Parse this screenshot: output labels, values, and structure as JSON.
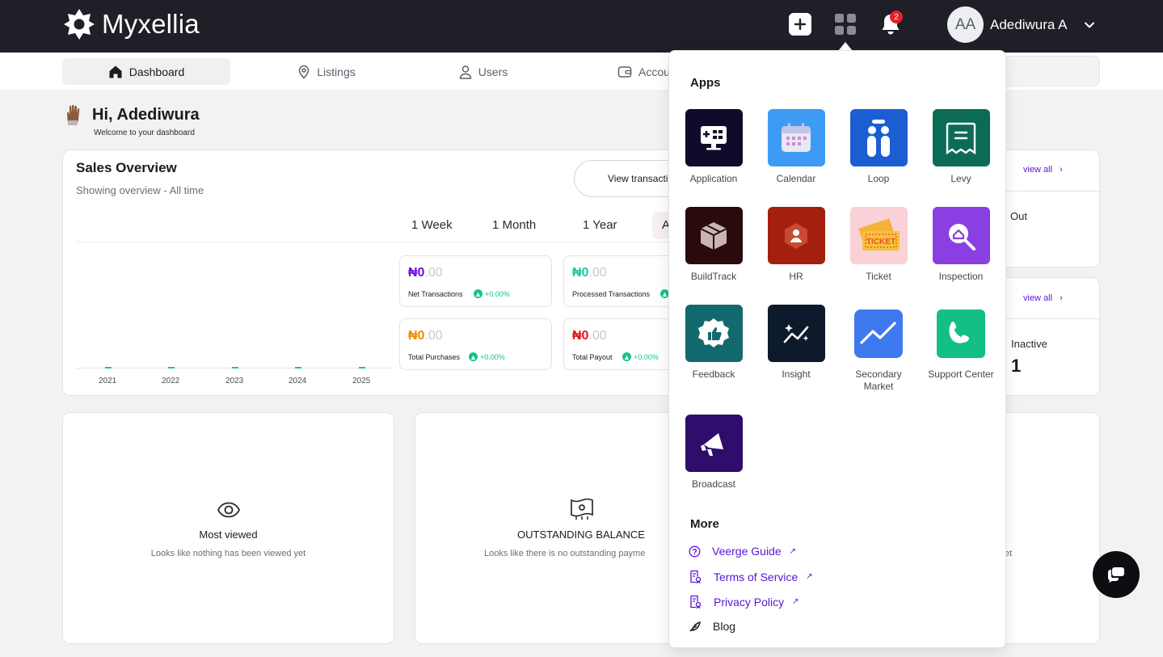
{
  "header": {
    "brand": "Myxellia",
    "notification_count": "2",
    "avatar_initials": "AA",
    "user_name": "Adediwura A"
  },
  "nav": {
    "items": [
      {
        "label": "Dashboard",
        "icon": "home-icon",
        "active": true
      },
      {
        "label": "Listings",
        "icon": "location-pin-icon"
      },
      {
        "label": "Users",
        "icon": "user-icon"
      },
      {
        "label": "Accou",
        "icon": "wallet-icon"
      }
    ]
  },
  "greeting": {
    "title": "Hi, Adediwura",
    "subtitle": "Welcome to your dashboard"
  },
  "sales_overview": {
    "title": "Sales Overview",
    "subtitle": "Showing overview - All time",
    "view_button": "View transacti",
    "periods": [
      "1 Week",
      "1 Month",
      "1 Year",
      "A"
    ],
    "years": [
      "2021",
      "2022",
      "2023",
      "2024",
      "2025"
    ],
    "stats": [
      {
        "currency": "₦0",
        "decimals": ".00",
        "label": "Net Transactions",
        "change": "+0.00%",
        "color": "#6b0fe0"
      },
      {
        "currency": "₦0",
        "decimals": ".00",
        "label": "Processed Transactions",
        "change": "",
        "color": "#1ac9a0"
      },
      {
        "currency": "₦0",
        "decimals": ".00",
        "label": "Total Purchases",
        "change": "+0.00%",
        "color": "#f08a00"
      },
      {
        "currency": "₦0",
        "decimals": ".00",
        "label": "Total Payout",
        "change": "+0.00%",
        "color": "#e0141c"
      }
    ]
  },
  "side_cards": [
    {
      "view_all": "view all",
      "text": "Out"
    },
    {
      "view_all": "view all",
      "text": "Inactive",
      "value": "1"
    }
  ],
  "empty_states": [
    {
      "title": "Most viewed",
      "subtitle": "Looks like nothing has been viewed yet",
      "icon": "eye-icon"
    },
    {
      "title": "OUTSTANDING BALANCE",
      "subtitle": "Looks like there is no outstanding payme",
      "icon": "money-icon"
    },
    {
      "subtitle": "et"
    }
  ],
  "apps_panel": {
    "apps_heading": "Apps",
    "more_heading": "More",
    "apps": [
      {
        "label": "Application",
        "icon": "monitor-icon",
        "bg": "#0f0b2a"
      },
      {
        "label": "Calendar",
        "icon": "calendar-icon",
        "bg": "#3e9bf4"
      },
      {
        "label": "Loop",
        "icon": "loop-icon",
        "bg": "#1b5ed2"
      },
      {
        "label": "Levy",
        "icon": "receipt-icon",
        "bg": "#0c6b55"
      },
      {
        "label": "BuildTrack",
        "icon": "box-icon",
        "bg": "#2b0a0d"
      },
      {
        "label": "HR",
        "icon": "hr-badge-icon",
        "bg": "#a3200e"
      },
      {
        "label": "Ticket",
        "icon": "ticket-icon",
        "bg": "#f9d1d6"
      },
      {
        "label": "Inspection",
        "icon": "search-home-icon",
        "bg": "#8a3fe2"
      },
      {
        "label": "Feedback",
        "icon": "thumbs-up-icon",
        "bg": "#126a6f"
      },
      {
        "label": "Insight",
        "icon": "insight-icon",
        "bg": "#0d1a2c"
      },
      {
        "label": "Secondary Market",
        "icon": "trend-icon",
        "bg": "#3f79f0"
      },
      {
        "label": "Support Center",
        "icon": "phone-icon",
        "bg": "#14bf84"
      },
      {
        "label": "Broadcast",
        "icon": "megaphone-icon",
        "bg": "#2e0d6c"
      }
    ],
    "more_links": [
      {
        "label": "Veerge Guide",
        "icon": "question-icon",
        "external": "↗"
      },
      {
        "label": "Terms of Service",
        "icon": "document-icon",
        "external": "↗"
      },
      {
        "label": "Privacy Policy",
        "icon": "document-icon",
        "external": "↗"
      },
      {
        "label": "Blog",
        "icon": "blog-icon",
        "external": ""
      }
    ]
  }
}
